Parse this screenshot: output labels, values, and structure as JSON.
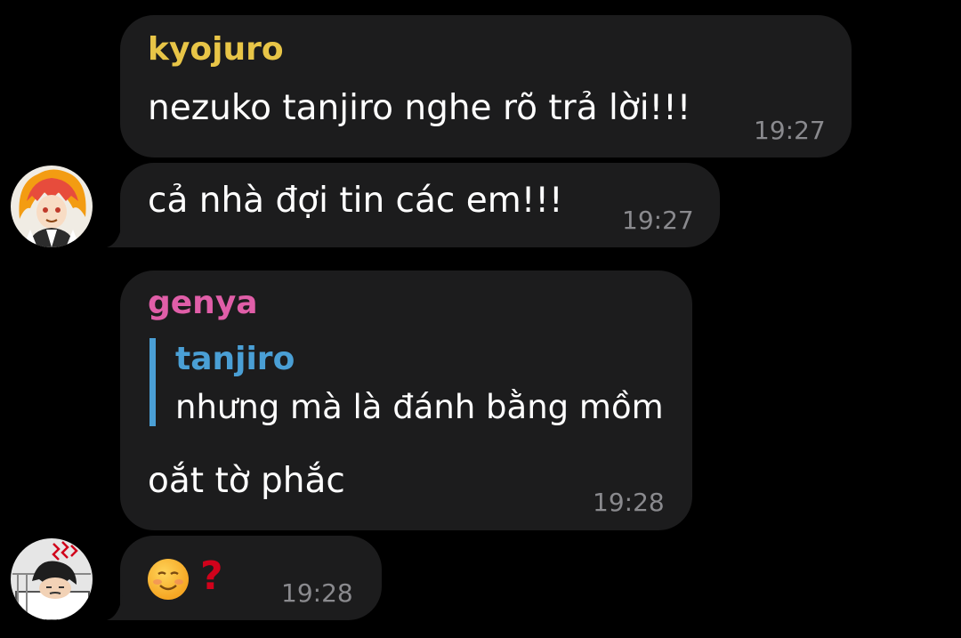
{
  "colors": {
    "background": "#000000",
    "bubble": "#1c1c1d",
    "kyojuro_name": "#e8c547",
    "genya_name": "#e05ea8",
    "reply_accent": "#4a9fd5",
    "timestamp": "#8a8a8e"
  },
  "messages": [
    {
      "sender": "kyojuro",
      "text": "nezuko tanjiro nghe rõ trả lời!!!",
      "time": "19:27"
    },
    {
      "sender": "",
      "text": "cả nhà đợi tin các em!!!",
      "time": "19:27"
    },
    {
      "sender": "genya",
      "reply": {
        "name": "tanjiro",
        "text": "nhưng mà là đánh bằng mồm"
      },
      "text": "oắt tờ phắc",
      "time": "19:28"
    },
    {
      "sender": "",
      "emoji": "☺️❓",
      "time": "19:28"
    }
  ],
  "avatars": [
    {
      "icon": "kyojuro-avatar"
    },
    {
      "icon": "genya-avatar"
    }
  ]
}
